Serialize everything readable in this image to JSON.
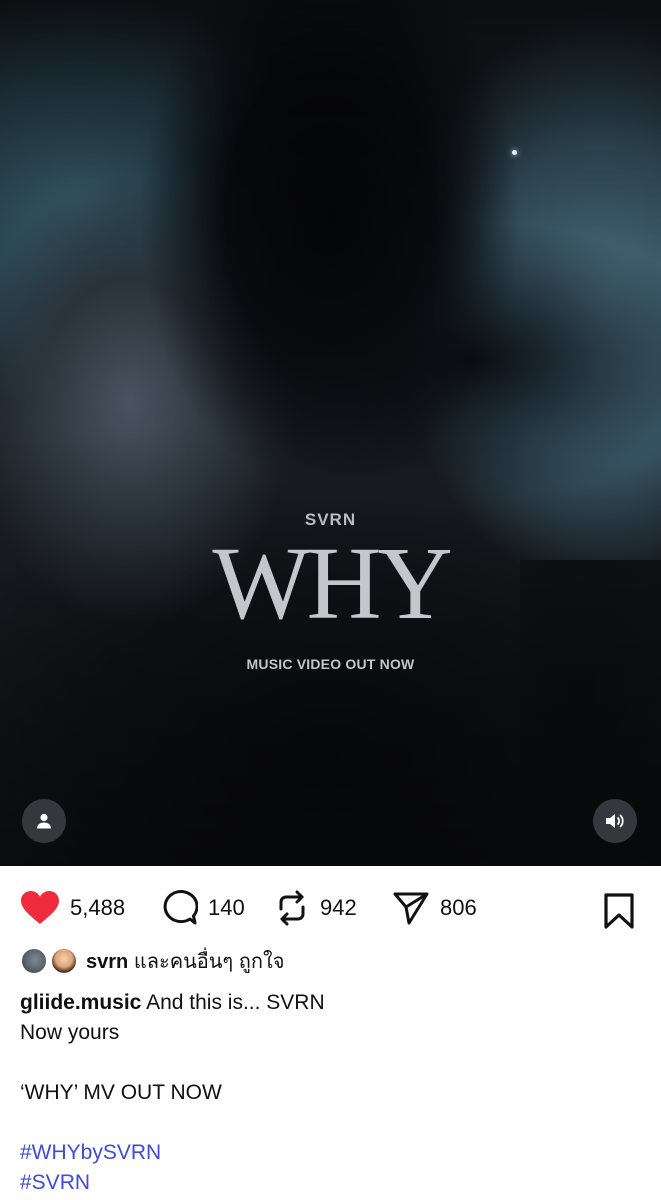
{
  "media": {
    "artist": "SVRN",
    "title": "WHY",
    "subtitle": "MUSIC VIDEO OUT NOW",
    "user_icon": "person-icon",
    "sound_icon": "speaker-icon"
  },
  "actions": {
    "like_count": "5,488",
    "comment_count": "140",
    "repost_count": "942",
    "share_count": "806",
    "like_color": "#ef2b3d"
  },
  "liked_by": {
    "username": "svrn",
    "suffix": "และคนอื่นๆ ถูกใจ"
  },
  "caption": {
    "username": "gliide.music",
    "first_line": "And this is... SVRN",
    "line2": "Now yours",
    "line3": "‘WHY’ MV OUT NOW",
    "hashtags": [
      "#WHYbySVRN",
      "#SVRN"
    ]
  },
  "colors": {
    "hashtag": "#3f4bd1"
  }
}
